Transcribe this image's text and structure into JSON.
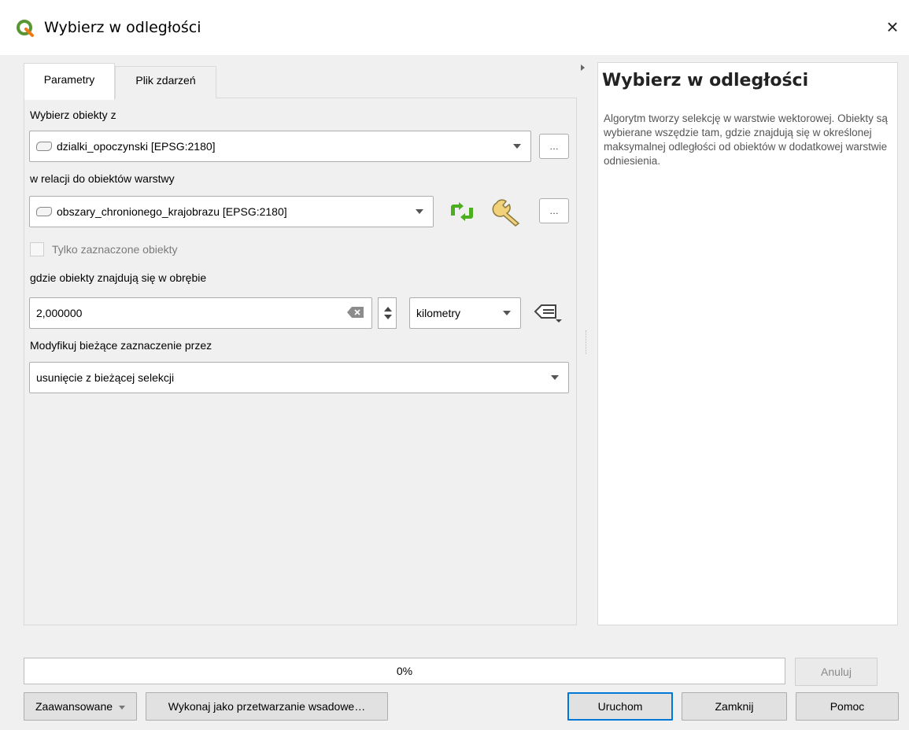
{
  "window": {
    "title": "Wybierz w odległości",
    "close_glyph": "×"
  },
  "tabs": [
    {
      "label": "Parametry"
    },
    {
      "label": "Plik zdarzeń"
    }
  ],
  "params": {
    "select_from_label": "Wybierz obiekty z",
    "select_from_value": "dzialki_opoczynski [EPSG:2180]",
    "relation_label": "w relacji do obiektów warstwy",
    "relation_value": "obszary_chronionego_krajobrazu [EPSG:2180]",
    "selected_only_label": "Tylko zaznaczone obiekty",
    "distance_label": "gdzie obiekty znajdują się w obrębie",
    "distance_value": "2,000000",
    "unit_value": "kilometry",
    "modify_label": "Modyfikuj bieżące zaznaczenie przez",
    "modify_value": "usunięcie z bieżącej selekcji",
    "ellipsis_label": "…"
  },
  "help": {
    "title": "Wybierz w odległości",
    "body": "Algorytm tworzy selekcję w warstwie wektorowej. Obiekty są wybierane wszędzie tam, gdzie znajdują się w określonej maksymalnej odległości od obiektów w dodatkowej warstwie odniesienia."
  },
  "progress": {
    "text": "0%",
    "value": 0
  },
  "buttons": {
    "cancel": "Anuluj",
    "advanced": "Zaawansowane",
    "batch": "Wykonaj jako przetwarzanie wsadowe…",
    "run": "Uruchom",
    "close": "Zamknij",
    "help": "Pomoc"
  },
  "colors": {
    "accent": "#0078d7",
    "qgis_green": "#589632",
    "iterate_green": "#4caf1f"
  }
}
